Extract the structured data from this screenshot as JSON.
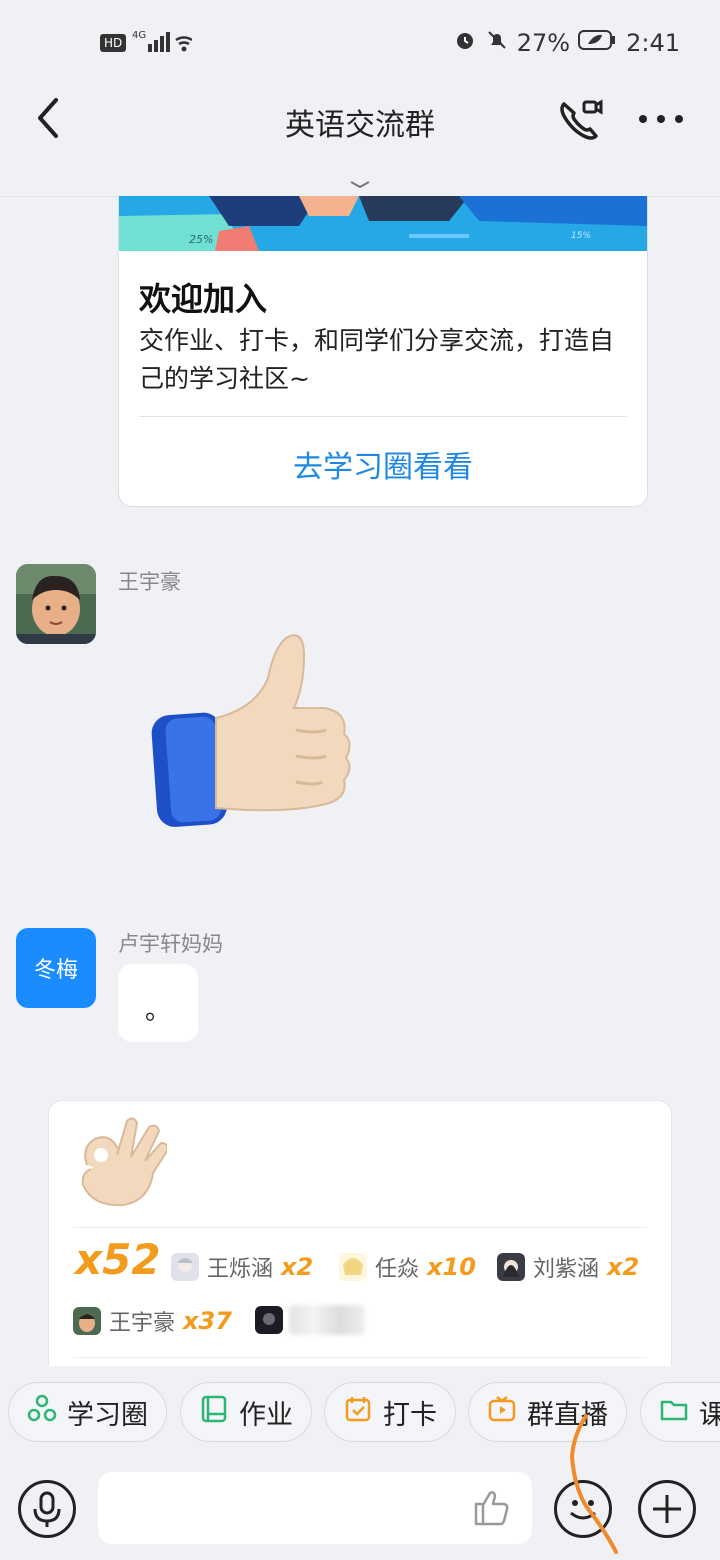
{
  "status_bar": {
    "left": "HD 4G",
    "battery": "27%",
    "time": "2:41"
  },
  "header": {
    "title": "英语交流群"
  },
  "welcome_card": {
    "banner_tags": [
      "25%",
      "15%"
    ],
    "title": "欢迎加入",
    "description": "交作业、打卡，和同学们分享交流，打造自己的学习社区~",
    "link": "去学习圈看看"
  },
  "messages": [
    {
      "sender": "王宇豪",
      "type": "sticker",
      "sticker": "thumbs-up"
    },
    {
      "sender": "卢宇轩妈妈",
      "avatar_text": "冬梅",
      "text": "。"
    }
  ],
  "reaction_card": {
    "emoji": "ok-hand",
    "total": "x52",
    "reactors": [
      {
        "name": "王烁涵",
        "count": "x2"
      },
      {
        "name": "任焱",
        "count": "x10"
      },
      {
        "name": "刘紫涵",
        "count": "x2"
      },
      {
        "name": "王宇豪",
        "count": "x37"
      }
    ]
  },
  "quick_actions": [
    {
      "label": "学习圈",
      "icon": "circle-nodes-icon",
      "color": "#2bb673"
    },
    {
      "label": "作业",
      "icon": "book-icon",
      "color": "#2bb673"
    },
    {
      "label": "打卡",
      "icon": "calendar-check-icon",
      "color": "#f29b1d"
    },
    {
      "label": "群直播",
      "icon": "tv-play-icon",
      "color": "#f29b1d"
    },
    {
      "label": "课",
      "icon": "folder-icon",
      "color": "#2bb673"
    }
  ],
  "colors": {
    "accent": "#1f88e5",
    "avatar_blue": "#1a8cff",
    "reaction_orange": "#f29b1d",
    "background": "#f0f1f5"
  }
}
